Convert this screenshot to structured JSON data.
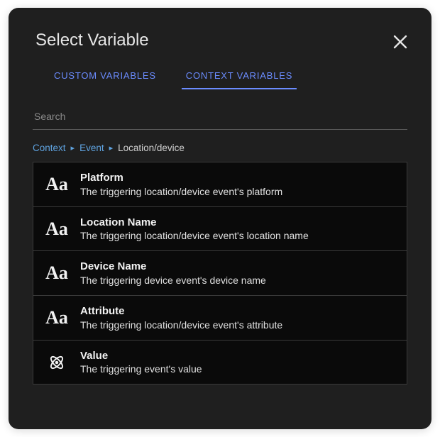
{
  "dialog": {
    "title": "Select Variable"
  },
  "tabs": {
    "custom": "CUSTOM VARIABLES",
    "context": "CONTEXT VARIABLES",
    "active": "context"
  },
  "search": {
    "placeholder": "Search",
    "value": ""
  },
  "breadcrumb": {
    "parts": [
      {
        "label": "Context",
        "link": true
      },
      {
        "label": "Event",
        "link": true
      },
      {
        "label": "Location/device",
        "link": false
      }
    ],
    "sep": "▸"
  },
  "items": [
    {
      "icon": "text",
      "name": "Platform",
      "desc": "The triggering location/device event's platform"
    },
    {
      "icon": "text",
      "name": "Location Name",
      "desc": "The triggering location/device event's location name"
    },
    {
      "icon": "text",
      "name": "Device Name",
      "desc": "The triggering device event's device name"
    },
    {
      "icon": "text",
      "name": "Attribute",
      "desc": "The triggering location/device event's attribute"
    },
    {
      "icon": "atom",
      "name": "Value",
      "desc": "The triggering event's value"
    }
  ]
}
